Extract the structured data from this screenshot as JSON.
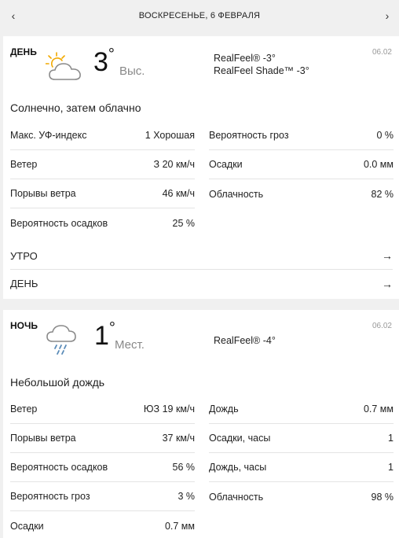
{
  "header": {
    "prev_icon": "chevron-left-icon",
    "next_icon": "chevron-right-icon",
    "prev_glyph": "‹",
    "next_glyph": "›",
    "date": "ВОСКРЕСЕНЬЕ, 6 ФЕВРАЛЯ"
  },
  "day": {
    "title": "ДЕНЬ",
    "date": "06.02",
    "icon": "partly-sunny-icon",
    "temp": "3",
    "temp_deg": "°",
    "temp_note": "Выс.",
    "realfeel": "RealFeel® -3°",
    "realfeel_shade": "RealFeel Shade™ -3°",
    "phrase": "Солнечно, затем облачно",
    "left": [
      {
        "label": "Макс. УФ-индекс",
        "value": "1 Хорошая"
      },
      {
        "label": "Ветер",
        "value": "З 20 км/ч"
      },
      {
        "label": "Порывы ветра",
        "value": "46 км/ч"
      },
      {
        "label": "Вероятность осадков",
        "value": "25 %"
      }
    ],
    "right": [
      {
        "label": "Вероятность гроз",
        "value": "0 %"
      },
      {
        "label": "Осадки",
        "value": "0.0 мм"
      },
      {
        "label": "Облачность",
        "value": "82 %"
      }
    ],
    "links": [
      {
        "label": "УТРО",
        "icon": "arrow-right-icon",
        "glyph": "→"
      },
      {
        "label": "ДЕНЬ",
        "icon": "arrow-right-icon",
        "glyph": "→"
      }
    ]
  },
  "night": {
    "title": "НОЧЬ",
    "date": "06.02",
    "icon": "cloud-rain-icon",
    "temp": "1",
    "temp_deg": "°",
    "temp_note": "Мест.",
    "realfeel": "RealFeel® -4°",
    "phrase": "Небольшой дождь",
    "left": [
      {
        "label": "Ветер",
        "value": "ЮЗ 19 км/ч"
      },
      {
        "label": "Порывы ветра",
        "value": "37 км/ч"
      },
      {
        "label": "Вероятность осадков",
        "value": "56 %"
      },
      {
        "label": "Вероятность гроз",
        "value": "3 %"
      },
      {
        "label": "Осадки",
        "value": "0.7 мм"
      }
    ],
    "right": [
      {
        "label": "Дождь",
        "value": "0.7 мм"
      },
      {
        "label": "Осадки, часы",
        "value": "1"
      },
      {
        "label": "Дождь, часы",
        "value": "1"
      },
      {
        "label": "Облачность",
        "value": "98 %"
      }
    ]
  },
  "colors": {
    "background": "#f0f0f0",
    "card": "#ffffff",
    "sun": "#f2a900",
    "cloud_stroke": "#8a8a8a",
    "rain": "#5a8bb8"
  }
}
